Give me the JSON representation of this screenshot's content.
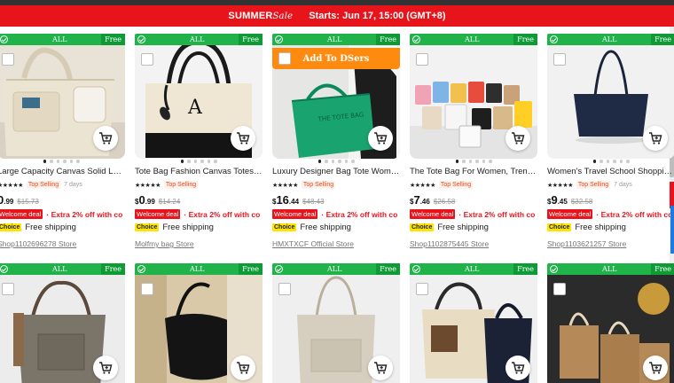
{
  "banner": {
    "brand_summer": "SUMMER",
    "brand_sale": "Sale",
    "starts_text": "Starts:  Jun 17, 15:00 (GMT+8)",
    "color": "#e8141c"
  },
  "overlay": {
    "all_label": "ALL",
    "free_label": "Free",
    "dsers_label": "Add To DSers",
    "green": "#1fb34a",
    "orange": "#ff8a10"
  },
  "products": [
    {
      "title": "Large Capacity Canvas Solid Let…",
      "badge": "Top Selling",
      "days": "7 days",
      "price_prefix": "",
      "price_int": "0",
      "price_dec": ".99",
      "price_old": "$15.73",
      "welcome": "Welcome deal",
      "extra": "· Extra 2% off with co",
      "choice": "Choice",
      "shipping": "Free shipping",
      "store": "Shop1102696278 Store"
    },
    {
      "title": "Tote Bag Fashion Canvas Totes …",
      "badge": "Top Selling",
      "days": "",
      "price_prefix": "$",
      "price_int": "0",
      "price_dec": ".99",
      "price_old": "$14.24",
      "welcome": "Welcome deal",
      "extra": "· Extra 2% off with co",
      "choice": "Choice",
      "shipping": "Free shipping",
      "store": "Molfmy bag Store",
      "monogram": "A"
    },
    {
      "title": "Luxury Designer Bag Tote Wom…",
      "badge": "Top Selling",
      "days": "",
      "price_prefix": "$",
      "price_int": "16",
      "price_dec": ".44",
      "price_old": "$48.43",
      "welcome": "Welcome deal",
      "extra": "· Extra 2% off with co",
      "choice": "Choice",
      "shipping": "Free shipping",
      "store": "HMXTXCF Official Store",
      "bag_print": "THE TOTE BAG"
    },
    {
      "title": "The Tote Bag For Women, Tren…",
      "badge": "Top Selling",
      "days": "",
      "price_prefix": "$",
      "price_int": "7",
      "price_dec": ".46",
      "price_old": "$26.58",
      "welcome": "Welcome deal",
      "extra": "· Extra 2% off with co",
      "choice": "Choice",
      "shipping": "Free shipping",
      "store": "Shop1102875445 Store"
    },
    {
      "title": "Women's Travel School Shoppi…",
      "badge": "Top Selling",
      "days": "7 days",
      "price_prefix": "$",
      "price_int": "9",
      "price_dec": ".45",
      "price_old": "$32.58",
      "welcome": "Welcome deal",
      "extra": "· Extra 2% off with co",
      "choice": "Choice",
      "shipping": "Free shipping",
      "store": "Shop1103621257 Store"
    }
  ],
  "icons": {
    "cart": "add-to-cart-icon",
    "check": "check-icon"
  }
}
